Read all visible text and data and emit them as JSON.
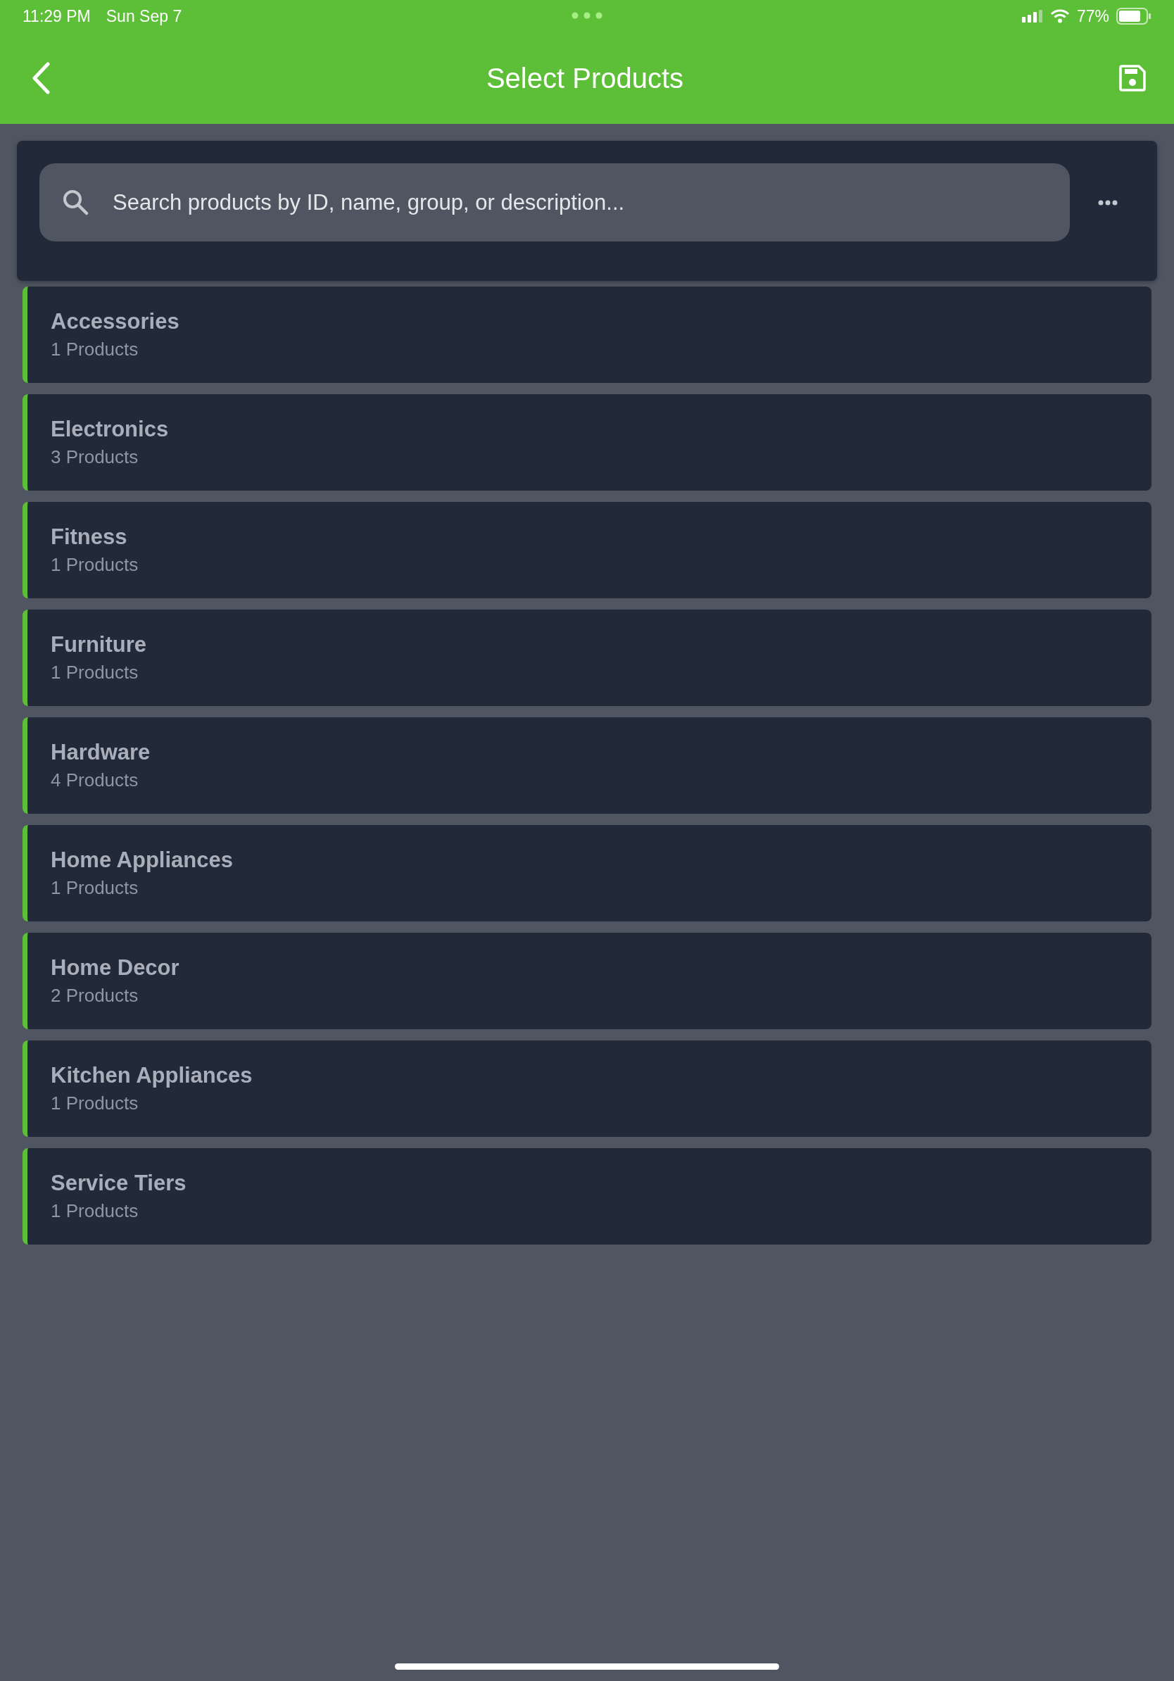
{
  "status_bar": {
    "time": "11:29 PM",
    "date": "Sun Sep 7",
    "battery": "77%"
  },
  "header": {
    "title": "Select Products"
  },
  "search": {
    "placeholder": "Search products by ID, name, group, or description..."
  },
  "groups": [
    {
      "name": "Accessories",
      "count": "1 Products"
    },
    {
      "name": "Electronics",
      "count": "3 Products"
    },
    {
      "name": "Fitness",
      "count": "1 Products"
    },
    {
      "name": "Furniture",
      "count": "1 Products"
    },
    {
      "name": "Hardware",
      "count": "4 Products"
    },
    {
      "name": "Home Appliances",
      "count": "1 Products"
    },
    {
      "name": "Home Decor",
      "count": "2 Products"
    },
    {
      "name": "Kitchen Appliances",
      "count": "1 Products"
    },
    {
      "name": "Service Tiers",
      "count": "1 Products"
    }
  ]
}
